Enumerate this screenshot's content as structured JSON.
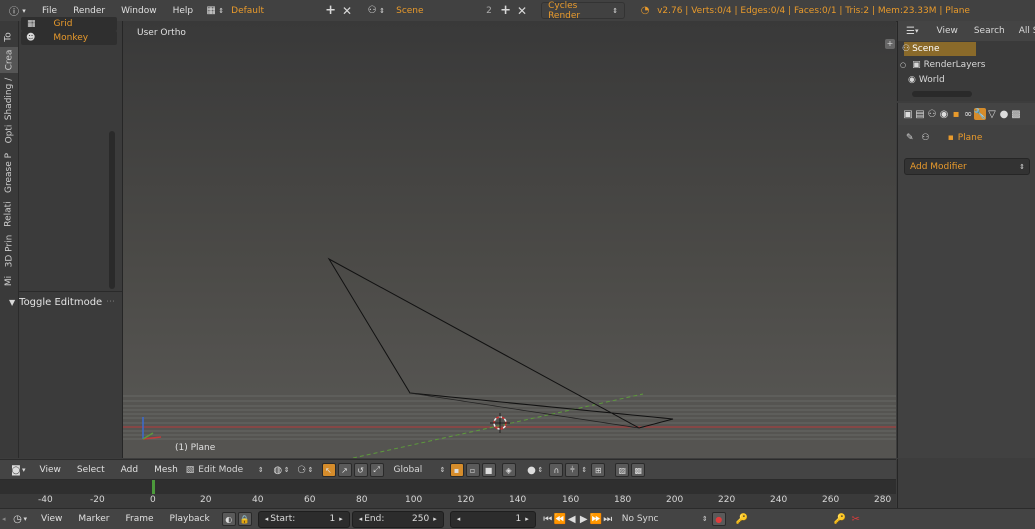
{
  "topbar": {
    "menus": [
      "File",
      "Render",
      "Window",
      "Help"
    ],
    "layout": "Default",
    "scene": "Scene",
    "scene_users": "2",
    "engine": "Cycles Render",
    "info": "v2.76 | Verts:0/4 | Edges:0/4 | Faces:0/1 | Tris:2 | Mem:23.33M | Plane"
  },
  "toolshelf": {
    "tabs": [
      "To",
      "Crea",
      "Shading /",
      "Opti",
      "Grease P",
      "Relati",
      "3D Prin",
      "Mi"
    ],
    "items": [
      "Grid",
      "Monkey"
    ],
    "operator_panel": "Toggle Editmode"
  },
  "viewport": {
    "view_label": "User Ortho",
    "object_label": "(1) Plane"
  },
  "outliner": {
    "header": [
      "View",
      "Search",
      "All Sc"
    ],
    "items": [
      "Scene",
      "RenderLayers",
      "World"
    ]
  },
  "properties": {
    "object_name": "Plane",
    "add_modifier": "Add Modifier"
  },
  "view3d_header": {
    "menus": [
      "View",
      "Select",
      "Add",
      "Mesh"
    ],
    "mode": "Edit Mode",
    "orientation": "Global"
  },
  "timeline": {
    "ticks": [
      "-40",
      "-20",
      "0",
      "20",
      "40",
      "60",
      "80",
      "100",
      "120",
      "140",
      "160",
      "180",
      "200",
      "220",
      "240",
      "260",
      "280"
    ],
    "current_frame": 1
  },
  "timeline_header": {
    "menus": [
      "View",
      "Marker",
      "Frame",
      "Playback"
    ],
    "start_label": "Start:",
    "start_value": "1",
    "end_label": "End:",
    "end_value": "250",
    "current_value": "1",
    "sync": "No Sync"
  },
  "colors": {
    "accent": "#e89a2c",
    "x_axis": "#b83a3a",
    "y_axis": "#5d9a3c"
  }
}
